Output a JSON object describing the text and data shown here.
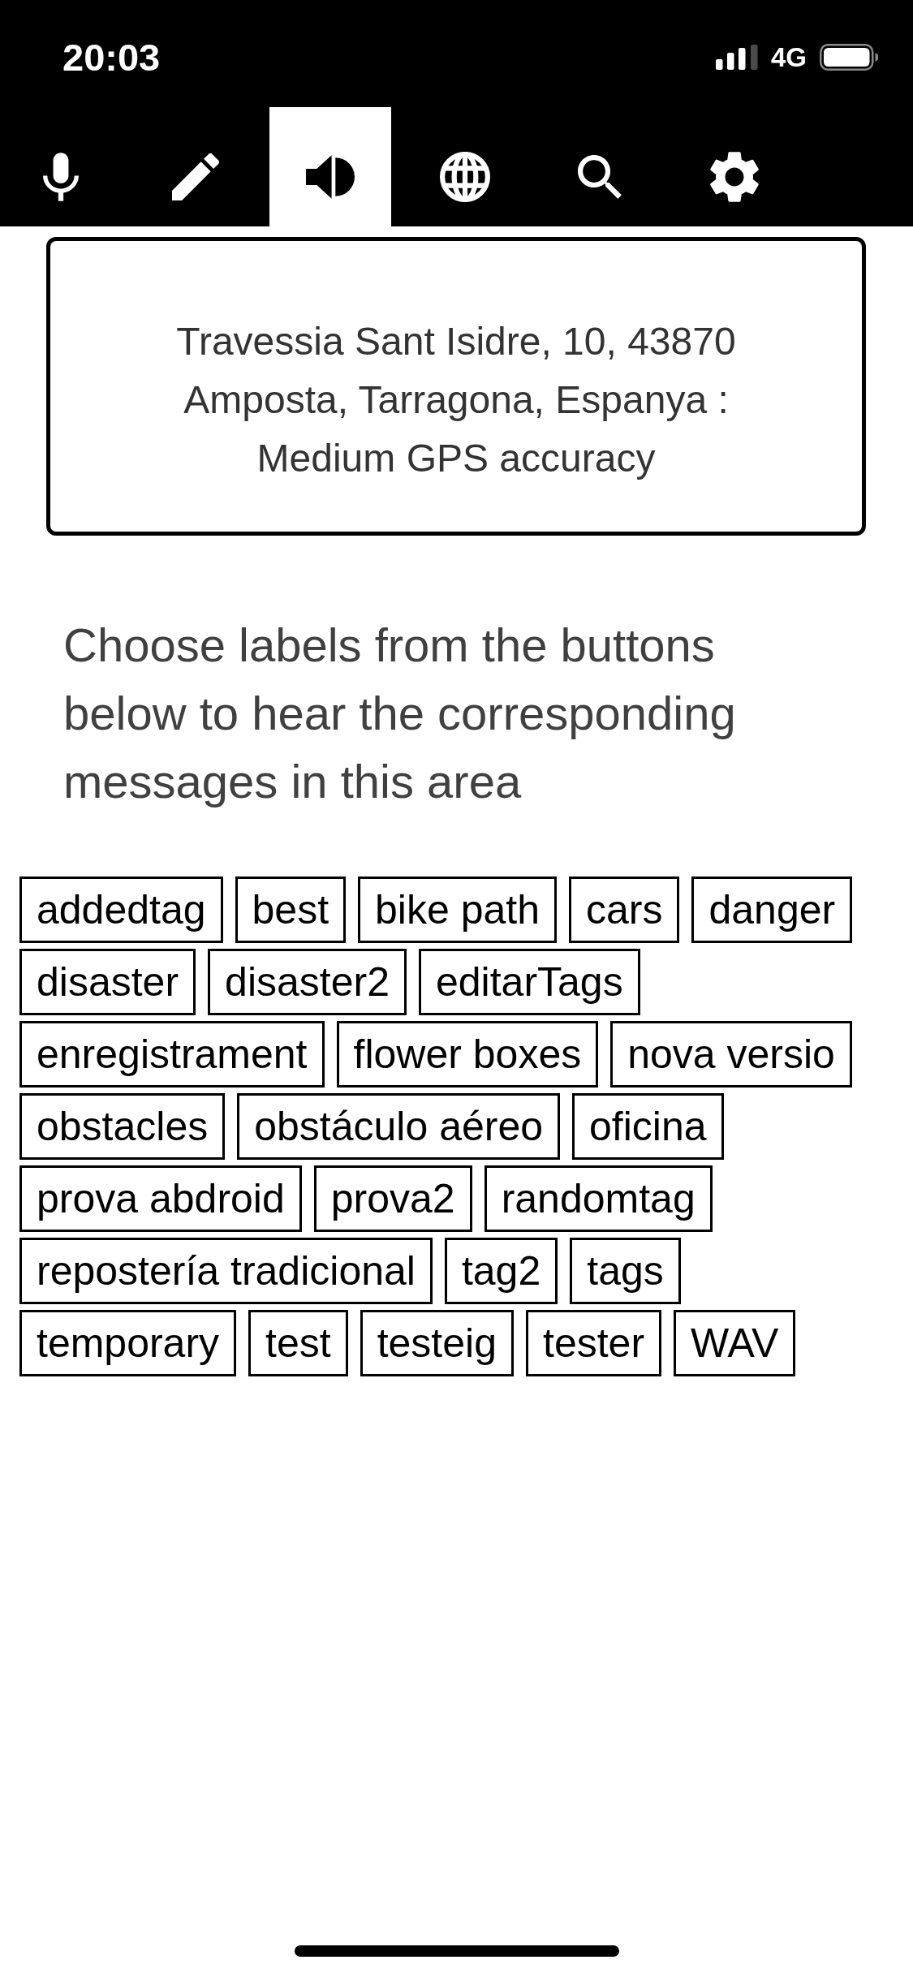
{
  "status_bar": {
    "time": "20:03",
    "network": "4G"
  },
  "tabs": [
    {
      "kind": "microphone",
      "selected": false
    },
    {
      "kind": "pencil",
      "selected": false
    },
    {
      "kind": "speaker",
      "selected": true
    },
    {
      "kind": "globe",
      "selected": false
    },
    {
      "kind": "search",
      "selected": false
    },
    {
      "kind": "settings",
      "selected": false
    }
  ],
  "location": {
    "text": "Travessia Sant Isidre, 10, 43870 Amposta, Tarragona, Espanya : Medium GPS accuracy"
  },
  "instructions": "Choose labels from the buttons below to hear the corresponding messages in this area",
  "tags": [
    "addedtag",
    "best",
    "bike path",
    "cars",
    "danger",
    "disaster",
    "disaster2",
    "editarTags",
    "enregistrament",
    "flower boxes",
    "nova versio",
    "obstacles",
    "obstáculo aéreo",
    "oficina",
    "prova abdroid",
    "prova2",
    "randomtag",
    "repostería tradicional",
    "tag2",
    "tags",
    "temporary",
    "test",
    "testeig",
    "tester",
    "WAV"
  ]
}
